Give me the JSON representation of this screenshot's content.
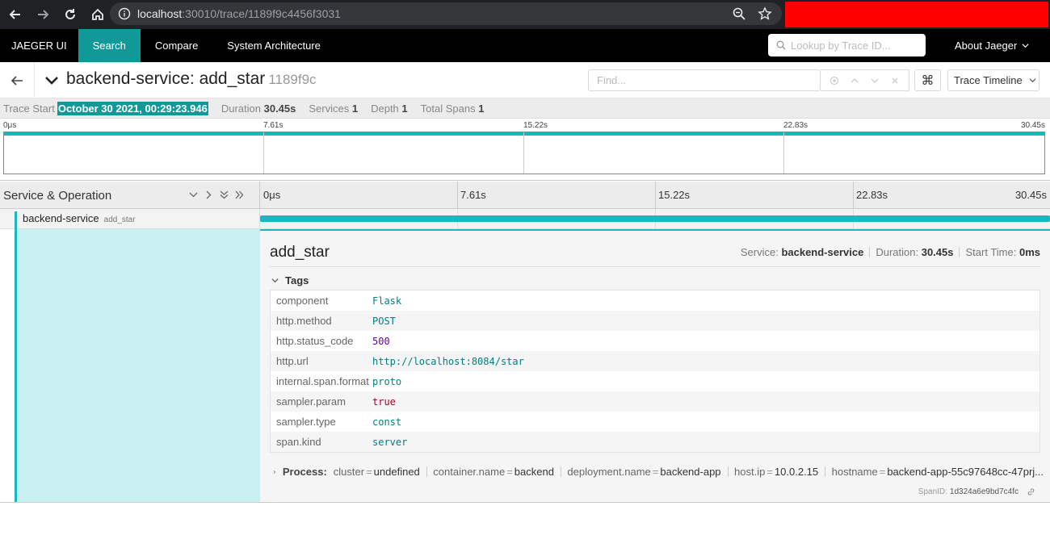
{
  "browser": {
    "url_host": "localhost",
    "url_rest": ":30010/trace/1189f9c4456f3031"
  },
  "topnav": {
    "brand": "JAEGER UI",
    "items": [
      "Search",
      "Compare",
      "System Architecture"
    ],
    "active_item": "Search",
    "lookup_placeholder": "Lookup by Trace ID...",
    "about": "About Jaeger"
  },
  "trace": {
    "title": "backend-service: add_star",
    "short_id": "1189f9c",
    "find_placeholder": "Find...",
    "view_mode": "Trace Timeline"
  },
  "summary": {
    "start_label": "Trace Start",
    "start_value": "October 30 2021, 00:29:23.946",
    "duration_label": "Duration",
    "duration_value": "30.45s",
    "services_label": "Services",
    "services_value": "1",
    "depth_label": "Depth",
    "depth_value": "1",
    "total_spans_label": "Total Spans",
    "total_spans_value": "1"
  },
  "ticks": [
    "0μs",
    "7.61s",
    "15.22s",
    "22.83s",
    "30.45s"
  ],
  "timeline_header": {
    "title": "Service & Operation"
  },
  "span": {
    "service": "backend-service",
    "operation": "add_star"
  },
  "detail": {
    "operation": "add_star",
    "service_label": "Service:",
    "service_value": "backend-service",
    "duration_label": "Duration:",
    "duration_value": "30.45s",
    "start_label": "Start Time:",
    "start_value": "0ms",
    "tags_label": "Tags",
    "tags": [
      {
        "key": "component",
        "value": "Flask",
        "type": "str"
      },
      {
        "key": "http.method",
        "value": "POST",
        "type": "str"
      },
      {
        "key": "http.status_code",
        "value": "500",
        "type": "num"
      },
      {
        "key": "http.url",
        "value": "http://localhost:8084/star",
        "type": "str"
      },
      {
        "key": "internal.span.format",
        "value": "proto",
        "type": "str"
      },
      {
        "key": "sampler.param",
        "value": "true",
        "type": "bool"
      },
      {
        "key": "sampler.type",
        "value": "const",
        "type": "str"
      },
      {
        "key": "span.kind",
        "value": "server",
        "type": "str"
      }
    ],
    "process_label": "Process:",
    "process": [
      {
        "key": "cluster",
        "value": "undefined"
      },
      {
        "key": "container.name",
        "value": "backend"
      },
      {
        "key": "deployment.name",
        "value": "backend-app"
      },
      {
        "key": "host.ip",
        "value": "10.0.2.15"
      },
      {
        "key": "hostname",
        "value": "backend-app-55c97648cc-47prj..."
      }
    ],
    "span_id_label": "SpanID:",
    "span_id_value": "1d324a6e9bd7c4fc"
  },
  "colors": {
    "accent": "#199999",
    "span_bar": "#17b8be",
    "redaction": "#ff0000"
  }
}
